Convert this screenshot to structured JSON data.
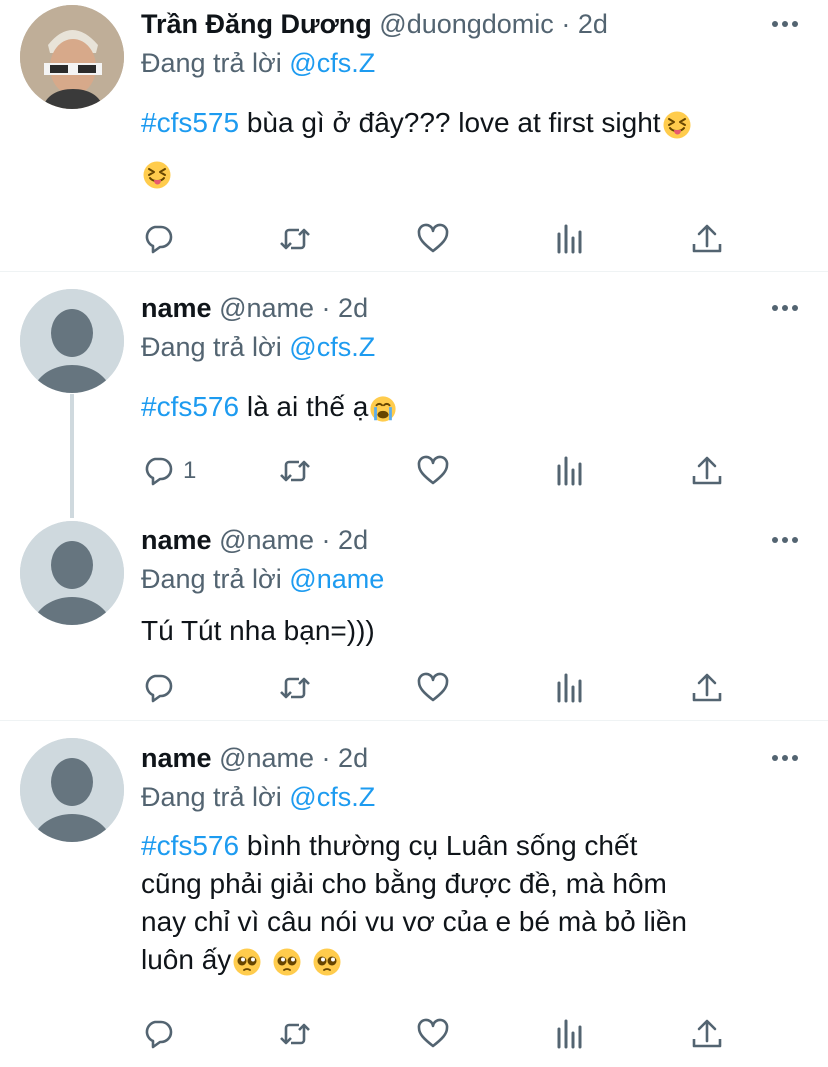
{
  "tweets": [
    {
      "name": "Trần Đăng Dương",
      "handle": "@duongdomic",
      "sep": "·",
      "time": "2d",
      "replying_prefix": "Đang trả lời",
      "replying_to": "@cfs.Z",
      "hashtag": "#cfs575",
      "text": " bùa gì ở đây??? love at first sight",
      "emojis": [
        "squinting-tongue-emoji",
        "squinting-tongue-emoji"
      ],
      "reply_count": "",
      "avatar": "photo-avatar"
    },
    {
      "name": "name",
      "handle": "@name",
      "sep": "·",
      "time": "2d",
      "replying_prefix": "Đang trả lời",
      "replying_to": "@cfs.Z",
      "hashtag": "#cfs576",
      "text": " là ai thế ạ",
      "emojis": [
        "crying-emoji"
      ],
      "reply_count": "1",
      "avatar": "default-avatar"
    },
    {
      "name": "name",
      "handle": "@name",
      "sep": "·",
      "time": "2d",
      "replying_prefix": "Đang trả lời",
      "replying_to": "@name",
      "hashtag": "",
      "text": "Tú Tút nha bạn=)))",
      "emojis": [],
      "reply_count": "",
      "avatar": "default-avatar"
    },
    {
      "name": "name",
      "handle": "@name",
      "sep": "·",
      "time": "2d",
      "replying_prefix": "Đang trả lời",
      "replying_to": "@cfs.Z",
      "hashtag": "#cfs576",
      "text_lines": [
        " bình thường cụ Luân sống chết",
        "cũng phải giải cho bằng được đề, mà hôm",
        "nay chỉ vì câu nói vu vơ của e bé mà bỏ liền",
        "luôn ấy"
      ],
      "emojis": [
        "pleading-face-emoji",
        "pleading-face-emoji",
        "pleading-face-emoji"
      ],
      "reply_count": "",
      "avatar": "default-avatar"
    }
  ],
  "icons": [
    "reply-icon",
    "retweet-icon",
    "like-icon",
    "analytics-icon",
    "share-icon",
    "more-icon"
  ],
  "colors": {
    "link": "#1d9bf0",
    "secondary": "#536471",
    "icon": "#536471",
    "divider": "#eff3f4"
  }
}
